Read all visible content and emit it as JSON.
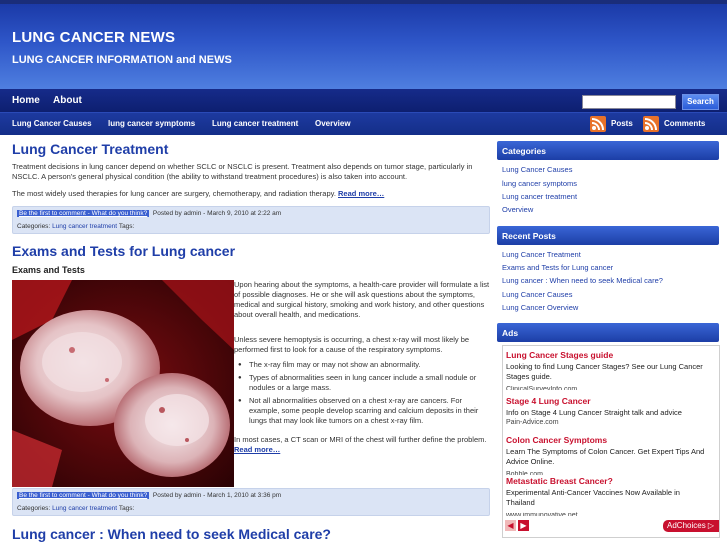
{
  "site": {
    "title": "LUNG CANCER NEWS",
    "subtitle": "LUNG CANCER INFORMATION and NEWS"
  },
  "nav_primary": [
    {
      "label": "Home"
    },
    {
      "label": "About"
    }
  ],
  "search": {
    "button_label": "Search",
    "value": ""
  },
  "nav_categories": [
    {
      "label": "Lung Cancer Causes"
    },
    {
      "label": "lung cancer symptoms"
    },
    {
      "label": "Lung cancer treatment"
    },
    {
      "label": "Overview"
    }
  ],
  "feeds": {
    "posts_label": "Posts",
    "comments_label": "Comments"
  },
  "posts": [
    {
      "title": "Lung Cancer Treatment",
      "paragraphs": [
        "Treatment decisions in lung cancer depend on whether SCLC or NSCLC is present. Treatment also depends on tumor stage, particularly in NSCLC. A person’s general physical condition (the ability to withstand treatment procedures) is also taken into account.",
        "The most widely used therapies for lung cancer are surgery, chemotherapy, and radiation therapy."
      ],
      "read_more": "Read more…",
      "comment_link": "Be the first to comment - What do you think?",
      "posted_by": "Posted by admin - March 9, 2010 at 2:22 am",
      "categories_label": "Categories:",
      "category": "Lung cancer treatment",
      "tags_label": "Tags:"
    },
    {
      "title": "Exams and Tests for Lung cancer",
      "subheading": "Exams and Tests",
      "paragraphs": [
        "Upon hearing about the symptoms, a health-care provider will formulate a list of possible diagnoses. He or she will ask questions about the symptoms, medical and surgical history, smoking and work history, and other questions about overall health, and medications.",
        "Unless severe hemoptysis is occurring, a chest x-ray will most likely be performed first to look for a cause of the respiratory symptoms."
      ],
      "bullets": [
        "The x-ray film may or may not show an abnormality.",
        "Types of abnormalities seen in lung cancer include a small nodule or nodules or a large mass.",
        "Not all abnormalities observed on a chest x-ray are cancers. For example, some people develop scarring and calcium deposits in their lungs that may look like tumors on a chest x-ray film."
      ],
      "closing": "In most cases, a CT scan or MRI of the chest will further define the problem.",
      "read_more": "Read more…",
      "comment_link": "Be the first to comment - What do you think?",
      "posted_by": "Posted by admin - March 1, 2010 at 3:36 pm",
      "categories_label": "Categories:",
      "category": "Lung cancer treatment",
      "tags_label": "Tags:"
    },
    {
      "title": "Lung cancer : When need to seek Medical care?"
    }
  ],
  "sidebar": {
    "categories": {
      "heading": "Categories",
      "items": [
        "Lung Cancer Causes",
        "lung cancer symptoms",
        "Lung cancer treatment",
        "Overview"
      ]
    },
    "recent": {
      "heading": "Recent Posts",
      "items": [
        "Lung Cancer Treatment",
        "Exams and Tests for Lung cancer",
        "Lung cancer : When need to seek Medical care?",
        "Lung Cancer Causes",
        "Lung Cancer Overview"
      ]
    },
    "ads": {
      "heading": "Ads",
      "items": [
        {
          "title": "Lung Cancer Stages guide",
          "text": "Looking to find Lung Cancer Stages? See our Lung Cancer Stages guide.",
          "url": "ClinicalSurveyInfo.com"
        },
        {
          "title": "Stage 4 Lung Cancer",
          "text": "Info on Stage 4 Lung Cancer Straight talk and advice",
          "url": "Pain-Advice.com"
        },
        {
          "title": "Colon Cancer Symptoms",
          "text": "Learn The Symptoms of Colon Cancer. Get Expert Tips And Advice Online.",
          "url": "Bobble.com"
        },
        {
          "title": "Metastatic Breast Cancer?",
          "text": "Experimental Anti-Cancer Vaccines Now Available in Thailand",
          "url": "www.immunovative.net"
        }
      ],
      "adchoices_label": "AdChoices"
    }
  },
  "colors": {
    "accent": "#1f3ea8",
    "header": "#2e56c8",
    "ad_title": "#c8102e",
    "rss": "#e8722a"
  }
}
